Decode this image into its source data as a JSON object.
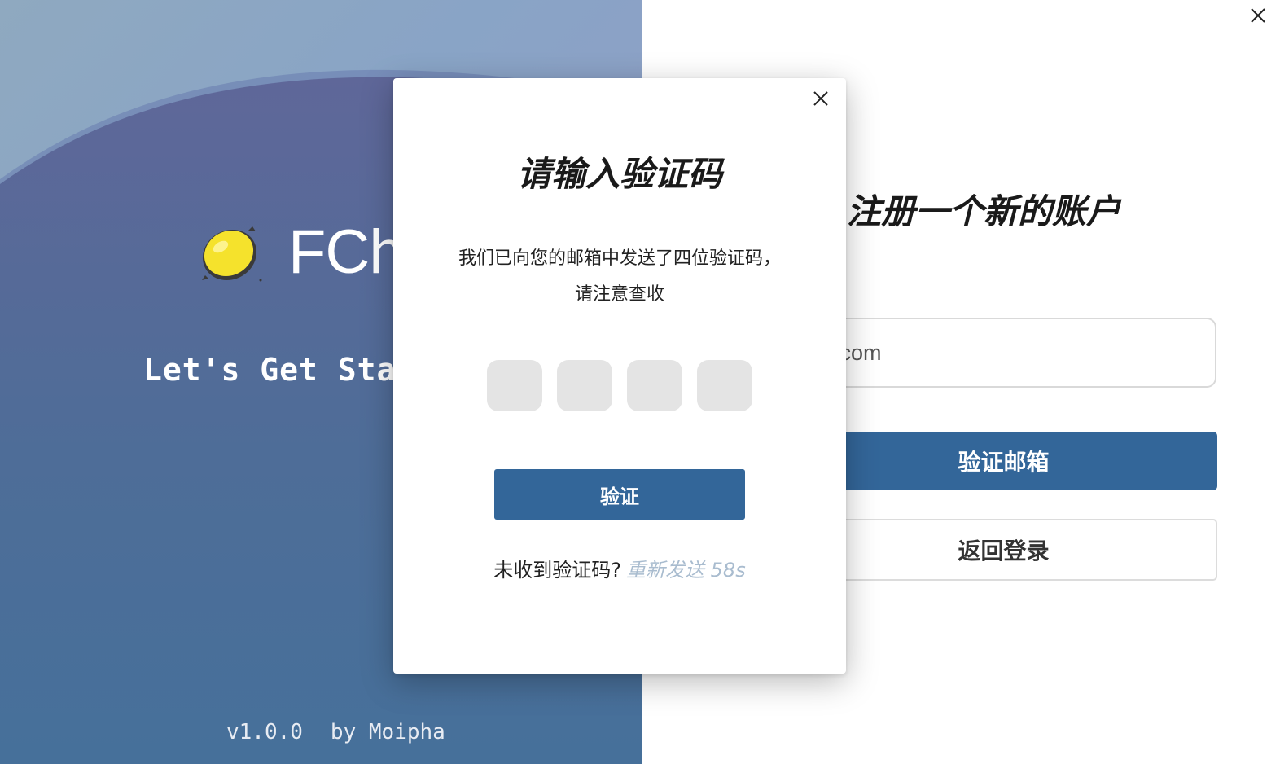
{
  "window": {
    "close_icon": "close-icon"
  },
  "hero": {
    "logo_icon": "lemon-icon",
    "app_name": "FChat",
    "tagline": "Let's Get Started",
    "version": "v1.0.0",
    "author": "by Moipha",
    "colors": {
      "gradient_top": "#8fa9c0",
      "gradient_mid": "#5f6799",
      "gradient_bottom": "#46709a"
    }
  },
  "register": {
    "title": "注册一个新的账户",
    "email_value": "il.com",
    "verify_email_label": "验证邮箱",
    "back_login_label": "返回登录"
  },
  "modal": {
    "close_icon": "close-icon",
    "title": "请输入验证码",
    "description_line1": "我们已向您的邮箱中发送了四位验证码，",
    "description_line2": "请注意查收",
    "code_boxes": [
      "",
      "",
      "",
      ""
    ],
    "verify_label": "验证",
    "resend_prompt": "未收到验证码?",
    "resend_link": "重新发送 58s"
  },
  "colors": {
    "primary": "#336699",
    "resend_link": "#a9bccf"
  }
}
